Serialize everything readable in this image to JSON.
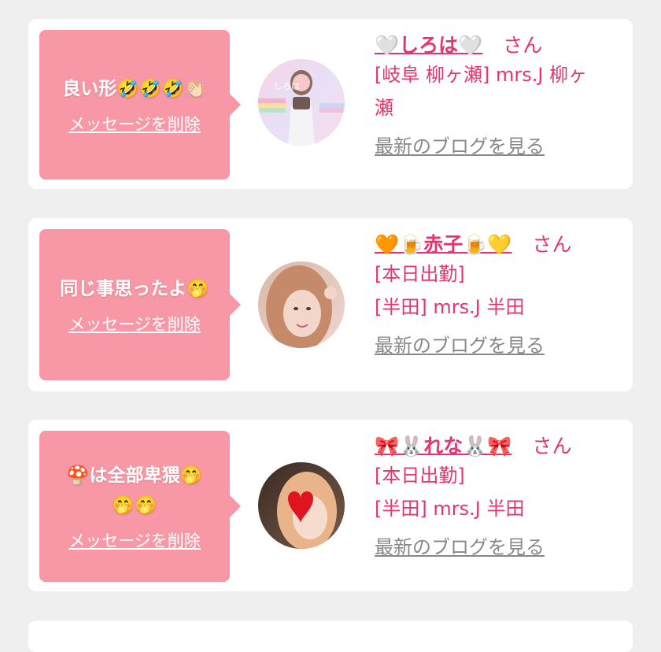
{
  "items": [
    {
      "message": "良い形🤣🤣🤣👏🏻",
      "delete_label": "メッセージを削除",
      "name": "🤍しろは🤍",
      "honorific": "さん",
      "line1": "[岐阜 柳ヶ瀬] mrs.J 柳ヶ",
      "line2": "瀬",
      "blog_label": "最新のブログを見る",
      "avatar_caption": "しろは"
    },
    {
      "message": "同じ事思ったよ🤭",
      "delete_label": "メッセージを削除",
      "name": "🧡🍺赤子🍺💛",
      "honorific": "さん",
      "line1": "[本日出勤]",
      "line2": "[半田] mrs.J 半田",
      "blog_label": "最新のブログを見る"
    },
    {
      "message": "🍄は全部卑猥🤭",
      "message2": "🤭🤭",
      "delete_label": "メッセージを削除",
      "name": "🎀🐰れな🐰🎀",
      "honorific": "さん",
      "line1": "[本日出勤]",
      "line2": "[半田] mrs.J 半田",
      "blog_label": "最新のブログを見る"
    }
  ],
  "colors": {
    "page_bg": "#efefef",
    "card_bg": "#ffffff",
    "bubble_bg": "#f898a6",
    "accent_pink": "#e8336e",
    "link_gray": "#888888"
  }
}
